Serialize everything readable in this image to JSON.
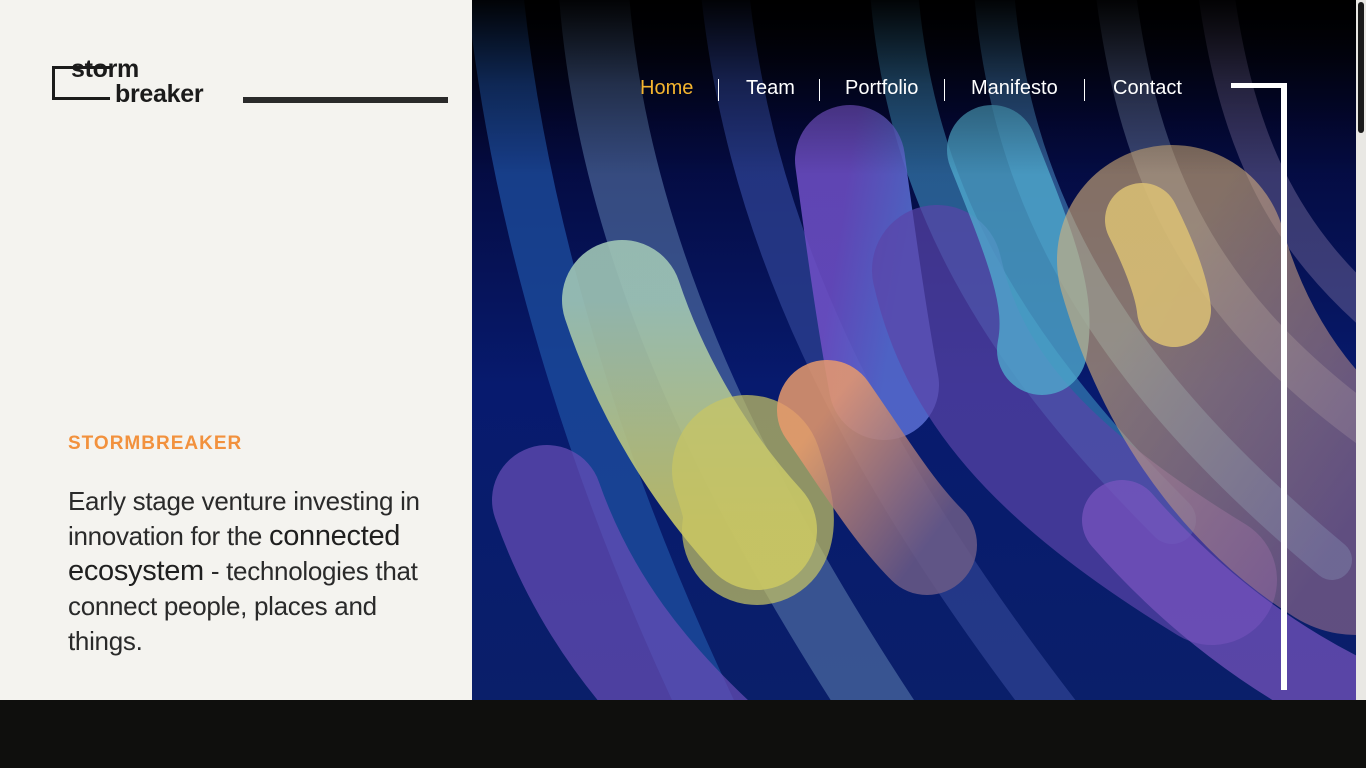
{
  "brand": {
    "logo_line1": "storm",
    "logo_line2": "breaker",
    "eyebrow": "STORMBREAKER",
    "accent_color": "#f2913d"
  },
  "hero": {
    "tagline_part1": "Early stage venture investing in innovation for the ",
    "tagline_highlight": "connected ecosystem",
    "tagline_part2": " - technologies that connect people, places and things."
  },
  "nav": {
    "items": [
      {
        "label": "Home",
        "active": true
      },
      {
        "label": "Team",
        "active": false
      },
      {
        "label": "Portfolio",
        "active": false
      },
      {
        "label": "Manifesto",
        "active": false
      },
      {
        "label": "Contact",
        "active": false
      }
    ],
    "active_color": "#f5b52f"
  }
}
